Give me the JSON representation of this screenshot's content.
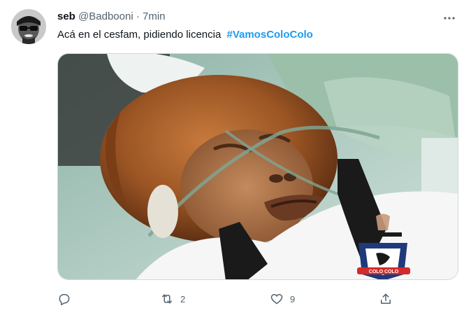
{
  "tweet": {
    "display_name": "seb",
    "handle": "@Badbooni",
    "separator": "·",
    "time": "7min",
    "text": "Acá en el cesfam, pidiendo licencia",
    "hashtag": "#VamosColoColo",
    "image_badge_text": "COLO COLO",
    "accent_color": "#1d9bf0",
    "actions": {
      "reply": {
        "icon": "reply-icon",
        "count": ""
      },
      "retweet": {
        "icon": "retweet-icon",
        "count": "2"
      },
      "like": {
        "icon": "heart-icon",
        "count": "9"
      },
      "share": {
        "icon": "share-icon",
        "count": ""
      }
    }
  }
}
